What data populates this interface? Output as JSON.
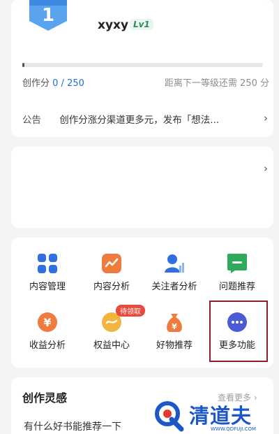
{
  "profile": {
    "level_number": "1",
    "username": "xyxy",
    "level_tag": "Lv1",
    "progress_fraction": 0.0,
    "score_label": "创作分",
    "score_value": "0 / 250",
    "next_level_text": "距离下一等级还需 250 分"
  },
  "notice": {
    "tag": "公告",
    "text": "创作分涨分渠道更多元，发布「想法...",
    "chevron": "›"
  },
  "mid_card": {
    "chevron": "›"
  },
  "functions": [
    {
      "label": "内容管理",
      "icon": "grid-icon",
      "color": "#2f6fe0"
    },
    {
      "label": "内容分析",
      "icon": "trend-chart-icon",
      "color": "#f07b3f"
    },
    {
      "label": "关注者分析",
      "icon": "follower-chart-icon",
      "color": "#2f6fe0"
    },
    {
      "label": "问题推荐",
      "icon": "question-bubble-icon",
      "color": "#2faa5b"
    },
    {
      "label": "收益分析",
      "icon": "yen-coin-icon",
      "color": "#f07b3f"
    },
    {
      "label": "权益中心",
      "icon": "rights-icon",
      "color": "#f2b43a",
      "pill": "待领取"
    },
    {
      "label": "好物推荐",
      "icon": "money-bag-icon",
      "color": "#f07b3f"
    },
    {
      "label": "更多功能",
      "icon": "more-dots-icon",
      "color": "#4b5bd6"
    }
  ],
  "inspiration": {
    "title": "创作灵感",
    "more": "查看更多 ›",
    "first_item": "有什么好书能推荐一下"
  },
  "watermark": {
    "text": "清道夫",
    "url": "WWW.QDFUJI.COM"
  }
}
